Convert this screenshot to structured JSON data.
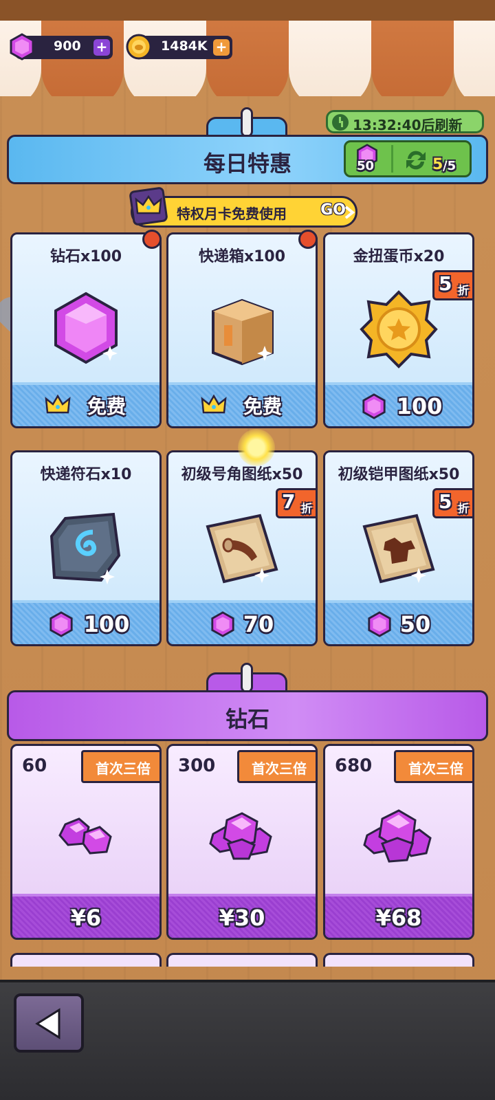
{
  "currency": {
    "gems": "900",
    "coins": "1484K",
    "plus": "+"
  },
  "daily_deals": {
    "title": "每日特惠",
    "refresh_timer": "13:32:40后刷新",
    "refresh_cost": "50",
    "refresh_count": "5",
    "refresh_total": "/5",
    "vip_text": "特权月卡免费使用",
    "vip_go": "GO"
  },
  "deals": [
    {
      "name": "钻石x100",
      "price": "免费",
      "currency": "crown",
      "badge": "",
      "red_dot": true
    },
    {
      "name": "快递箱x100",
      "price": "免费",
      "currency": "crown",
      "badge": "",
      "red_dot": true
    },
    {
      "name": "金扭蛋币x20",
      "price": "100",
      "currency": "gem",
      "badge": "5",
      "red_dot": false
    },
    {
      "name": "快递符石x10",
      "price": "100",
      "currency": "gem",
      "badge": "",
      "red_dot": false
    },
    {
      "name": "初级号角图纸x50",
      "price": "70",
      "currency": "gem",
      "badge": "7",
      "red_dot": false
    },
    {
      "name": "初级铠甲图纸x50",
      "price": "50",
      "currency": "gem",
      "badge": "5",
      "red_dot": false
    }
  ],
  "discount_suffix": "折",
  "gem_shop": {
    "title": "钻石",
    "items": [
      {
        "amount": "60",
        "tag": "首次三倍",
        "price": "¥6"
      },
      {
        "amount": "300",
        "tag": "首次三倍",
        "price": "¥30"
      },
      {
        "amount": "680",
        "tag": "首次三倍",
        "price": "¥68"
      }
    ]
  },
  "colors": {
    "daily_banner": "#5ab8f0",
    "gem_banner": "#b85ae8",
    "gem": "#d24ae6",
    "coin": "#f4b526",
    "outline": "#2a2340"
  },
  "icons": {
    "back": "back-arrow-icon",
    "timer": "clock-icon",
    "refresh": "refresh-icon",
    "vip": "crown-icon"
  }
}
